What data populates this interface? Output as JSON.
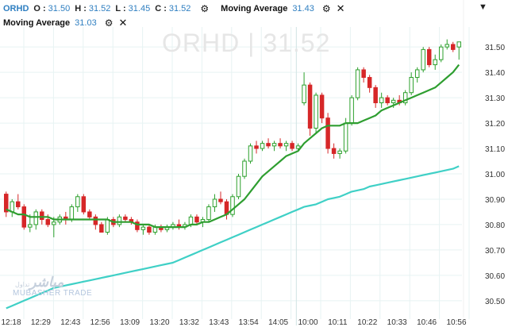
{
  "header": {
    "symbol": "ORHD",
    "o_label": "O :",
    "o_value": "31.50",
    "h_label": "H :",
    "h_value": "31.52",
    "l_label": "L :",
    "l_value": "31.45",
    "c_label": "C :",
    "c_value": "31.52",
    "ma1_label": "Moving Average",
    "ma1_value": "31.43",
    "ma2_label": "Moving Average",
    "ma2_value": "31.03",
    "settings_icon": "gear-icon",
    "close_icon": "close-icon",
    "collapse_icon": "triangle-down-icon"
  },
  "watermark": "ORHD  |  31.52",
  "logo": {
    "arabic": "مباشر",
    "arabic_small": "تداول",
    "english": "MUBASHER TRADE"
  },
  "colors": {
    "up": "#2ca02c",
    "down": "#d62728",
    "ma_fast": "#2e9e30",
    "ma_slow": "#3fd0c6",
    "grid": "#e7f3f3",
    "axis_text": "#333333",
    "label_accent": "#2f7fc1"
  },
  "chart_data": {
    "type": "candlestick",
    "ylim": [
      30.44,
      31.56
    ],
    "y_ticks": [
      30.5,
      30.6,
      30.7,
      30.8,
      30.9,
      31.0,
      31.1,
      31.2,
      31.3,
      31.4,
      31.5
    ],
    "y_tick_labels": [
      "30.50",
      "30.60",
      "30.70",
      "30.80",
      "30.90",
      "31.00",
      "31.10",
      "31.20",
      "31.30",
      "31.40",
      "31.50"
    ],
    "x_tick_labels": [
      "12:18",
      "12:29",
      "12:43",
      "12:56",
      "13:09",
      "13:20",
      "13:32",
      "13:43",
      "13:54",
      "14:05",
      "10:00",
      "10:11",
      "10:22",
      "10:33",
      "10:46",
      "10:56"
    ],
    "session_break_after_index": 9,
    "grid": true,
    "candles": [
      {
        "o": 30.92,
        "h": 30.93,
        "l": 30.83,
        "c": 30.85
      },
      {
        "o": 30.85,
        "h": 30.9,
        "l": 30.83,
        "c": 30.89
      },
      {
        "o": 30.89,
        "h": 30.92,
        "l": 30.86,
        "c": 30.87
      },
      {
        "o": 30.87,
        "h": 30.88,
        "l": 30.78,
        "c": 30.79
      },
      {
        "o": 30.79,
        "h": 30.84,
        "l": 30.77,
        "c": 30.8
      },
      {
        "o": 30.8,
        "h": 30.86,
        "l": 30.78,
        "c": 30.85
      },
      {
        "o": 30.85,
        "h": 30.86,
        "l": 30.8,
        "c": 30.82
      },
      {
        "o": 30.82,
        "h": 30.84,
        "l": 30.79,
        "c": 30.8
      },
      {
        "o": 30.8,
        "h": 30.83,
        "l": 30.75,
        "c": 30.81
      },
      {
        "o": 30.81,
        "h": 30.84,
        "l": 30.8,
        "c": 30.83
      },
      {
        "o": 30.83,
        "h": 30.85,
        "l": 30.8,
        "c": 30.82
      },
      {
        "o": 30.82,
        "h": 30.88,
        "l": 30.81,
        "c": 30.87
      },
      {
        "o": 30.87,
        "h": 30.92,
        "l": 30.85,
        "c": 30.91
      },
      {
        "o": 30.91,
        "h": 30.92,
        "l": 30.84,
        "c": 30.85
      },
      {
        "o": 30.85,
        "h": 30.86,
        "l": 30.82,
        "c": 30.83
      },
      {
        "o": 30.83,
        "h": 30.84,
        "l": 30.78,
        "c": 30.8
      },
      {
        "o": 30.8,
        "h": 30.81,
        "l": 30.77,
        "c": 30.77
      },
      {
        "o": 30.77,
        "h": 30.83,
        "l": 30.76,
        "c": 30.82
      },
      {
        "o": 30.82,
        "h": 30.83,
        "l": 30.79,
        "c": 30.8
      },
      {
        "o": 30.8,
        "h": 30.84,
        "l": 30.79,
        "c": 30.83
      },
      {
        "o": 30.83,
        "h": 30.84,
        "l": 30.81,
        "c": 30.82
      },
      {
        "o": 30.82,
        "h": 30.83,
        "l": 30.8,
        "c": 30.81
      },
      {
        "o": 30.81,
        "h": 30.82,
        "l": 30.77,
        "c": 30.78
      },
      {
        "o": 30.78,
        "h": 30.8,
        "l": 30.76,
        "c": 30.79
      },
      {
        "o": 30.79,
        "h": 30.8,
        "l": 30.76,
        "c": 30.77
      },
      {
        "o": 30.77,
        "h": 30.8,
        "l": 30.76,
        "c": 30.79
      },
      {
        "o": 30.79,
        "h": 30.8,
        "l": 30.77,
        "c": 30.78
      },
      {
        "o": 30.78,
        "h": 30.8,
        "l": 30.77,
        "c": 30.79
      },
      {
        "o": 30.79,
        "h": 30.81,
        "l": 30.78,
        "c": 30.8
      },
      {
        "o": 30.8,
        "h": 30.82,
        "l": 30.78,
        "c": 30.79
      },
      {
        "o": 30.79,
        "h": 30.81,
        "l": 30.78,
        "c": 30.8
      },
      {
        "o": 30.8,
        "h": 30.84,
        "l": 30.79,
        "c": 30.83
      },
      {
        "o": 30.83,
        "h": 30.84,
        "l": 30.8,
        "c": 30.81
      },
      {
        "o": 30.81,
        "h": 30.83,
        "l": 30.79,
        "c": 30.82
      },
      {
        "o": 30.82,
        "h": 30.88,
        "l": 30.81,
        "c": 30.87
      },
      {
        "o": 30.87,
        "h": 30.92,
        "l": 30.85,
        "c": 30.9
      },
      {
        "o": 30.9,
        "h": 30.93,
        "l": 30.88,
        "c": 30.89
      },
      {
        "o": 30.89,
        "h": 30.9,
        "l": 30.82,
        "c": 30.84
      },
      {
        "o": 30.84,
        "h": 30.92,
        "l": 30.83,
        "c": 30.91
      },
      {
        "o": 30.91,
        "h": 31.0,
        "l": 30.9,
        "c": 30.99
      },
      {
        "o": 30.99,
        "h": 31.06,
        "l": 30.98,
        "c": 31.05
      },
      {
        "o": 31.05,
        "h": 31.12,
        "l": 31.04,
        "c": 31.11
      },
      {
        "o": 31.11,
        "h": 31.13,
        "l": 31.08,
        "c": 31.1
      },
      {
        "o": 31.1,
        "h": 31.13,
        "l": 31.09,
        "c": 31.12
      },
      {
        "o": 31.12,
        "h": 31.14,
        "l": 31.1,
        "c": 31.11
      },
      {
        "o": 31.11,
        "h": 31.13,
        "l": 31.09,
        "c": 31.12
      },
      {
        "o": 31.12,
        "h": 31.14,
        "l": 31.1,
        "c": 31.11
      },
      {
        "o": 31.11,
        "h": 31.13,
        "l": 31.09,
        "c": 31.12
      },
      {
        "o": 31.12,
        "h": 31.13,
        "l": 31.09,
        "c": 31.1
      },
      {
        "o": 31.1,
        "h": 31.12,
        "l": 31.09,
        "c": 31.11
      },
      {
        "o": 31.28,
        "h": 31.4,
        "l": 31.27,
        "c": 31.35
      },
      {
        "o": 31.35,
        "h": 31.36,
        "l": 31.15,
        "c": 31.18
      },
      {
        "o": 31.18,
        "h": 31.32,
        "l": 31.16,
        "c": 31.31
      },
      {
        "o": 31.31,
        "h": 31.32,
        "l": 31.2,
        "c": 31.22
      },
      {
        "o": 31.22,
        "h": 31.24,
        "l": 31.08,
        "c": 31.1
      },
      {
        "o": 31.1,
        "h": 31.12,
        "l": 31.06,
        "c": 31.08
      },
      {
        "o": 31.08,
        "h": 31.1,
        "l": 31.06,
        "c": 31.09
      },
      {
        "o": 31.09,
        "h": 31.22,
        "l": 31.08,
        "c": 31.2
      },
      {
        "o": 31.2,
        "h": 31.31,
        "l": 31.19,
        "c": 31.3
      },
      {
        "o": 31.3,
        "h": 31.42,
        "l": 31.29,
        "c": 31.41
      },
      {
        "o": 31.41,
        "h": 31.42,
        "l": 31.36,
        "c": 31.38
      },
      {
        "o": 31.38,
        "h": 31.39,
        "l": 31.32,
        "c": 31.34
      },
      {
        "o": 31.34,
        "h": 31.35,
        "l": 31.26,
        "c": 31.28
      },
      {
        "o": 31.28,
        "h": 31.32,
        "l": 31.26,
        "c": 31.3
      },
      {
        "o": 31.3,
        "h": 31.31,
        "l": 31.27,
        "c": 31.28
      },
      {
        "o": 31.28,
        "h": 31.3,
        "l": 31.26,
        "c": 31.29
      },
      {
        "o": 31.29,
        "h": 31.31,
        "l": 31.27,
        "c": 31.28
      },
      {
        "o": 31.28,
        "h": 31.33,
        "l": 31.27,
        "c": 31.32
      },
      {
        "o": 31.32,
        "h": 31.4,
        "l": 31.31,
        "c": 31.38
      },
      {
        "o": 31.38,
        "h": 31.42,
        "l": 31.36,
        "c": 31.41
      },
      {
        "o": 31.41,
        "h": 31.5,
        "l": 31.4,
        "c": 31.49
      },
      {
        "o": 31.49,
        "h": 31.5,
        "l": 31.42,
        "c": 31.43
      },
      {
        "o": 31.43,
        "h": 31.47,
        "l": 31.41,
        "c": 31.45
      },
      {
        "o": 31.45,
        "h": 31.51,
        "l": 31.44,
        "c": 31.5
      },
      {
        "o": 31.5,
        "h": 31.53,
        "l": 31.49,
        "c": 31.51
      },
      {
        "o": 31.51,
        "h": 31.52,
        "l": 31.48,
        "c": 31.49
      },
      {
        "o": 31.5,
        "h": 31.52,
        "l": 31.45,
        "c": 31.52
      }
    ],
    "series": [
      {
        "name": "Moving Average",
        "role": "fast",
        "values": [
          30.86,
          30.85,
          30.84,
          30.84,
          30.83,
          30.83,
          30.83,
          30.83,
          30.82,
          30.82,
          30.82,
          30.82,
          30.82,
          30.82,
          30.82,
          30.82,
          30.82,
          30.82,
          30.81,
          30.81,
          30.81,
          30.81,
          30.8,
          30.8,
          30.8,
          30.79,
          30.79,
          30.79,
          30.79,
          30.79,
          30.79,
          30.8,
          30.8,
          30.81,
          30.81,
          30.82,
          30.83,
          30.84,
          30.86,
          30.88,
          30.9,
          30.93,
          30.96,
          30.99,
          31.01,
          31.03,
          31.05,
          31.07,
          31.08,
          31.09,
          31.12,
          31.14,
          31.16,
          31.18,
          31.19,
          31.19,
          31.19,
          31.2,
          31.2,
          31.2,
          31.21,
          31.22,
          31.23,
          31.25,
          31.26,
          31.27,
          31.28,
          31.29,
          31.3,
          31.31,
          31.32,
          31.33,
          31.34,
          31.36,
          31.38,
          31.4,
          31.43
        ]
      },
      {
        "name": "Moving Average",
        "role": "slow",
        "values": [
          30.47,
          30.48,
          30.49,
          30.5,
          30.51,
          30.52,
          30.53,
          30.54,
          30.55,
          30.555,
          30.56,
          30.565,
          30.57,
          30.575,
          30.58,
          30.585,
          30.59,
          30.595,
          30.6,
          30.605,
          30.61,
          30.615,
          30.62,
          30.625,
          30.63,
          30.635,
          30.64,
          30.645,
          30.65,
          30.66,
          30.67,
          30.68,
          30.69,
          30.7,
          30.71,
          30.72,
          30.73,
          30.74,
          30.75,
          30.76,
          30.77,
          30.78,
          30.79,
          30.8,
          30.81,
          30.82,
          30.83,
          30.84,
          30.85,
          30.86,
          30.87,
          30.875,
          30.88,
          30.89,
          30.9,
          30.905,
          30.91,
          30.92,
          30.93,
          30.935,
          30.94,
          30.95,
          30.955,
          30.96,
          30.965,
          30.97,
          30.975,
          30.98,
          30.985,
          30.99,
          30.995,
          31.0,
          31.005,
          31.01,
          31.015,
          31.02,
          31.03
        ]
      }
    ]
  }
}
